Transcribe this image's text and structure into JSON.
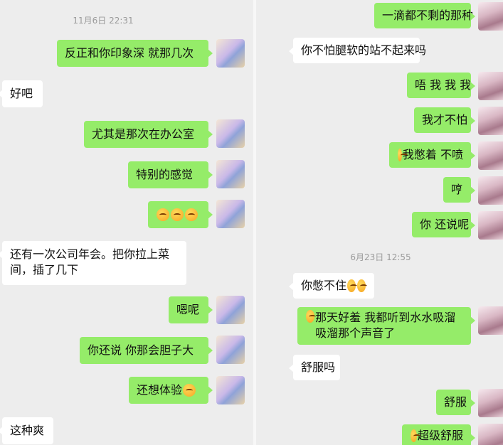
{
  "left": {
    "timestamp": "11月6日 22:31",
    "messages": [
      {
        "dir": "out",
        "text": "反正和你印象深 就那几次"
      },
      {
        "dir": "in",
        "text": "好吧"
      },
      {
        "dir": "out",
        "text": "尤其是那次在办公室"
      },
      {
        "dir": "out",
        "text": "特别的感觉"
      },
      {
        "dir": "out",
        "text": ""
      },
      {
        "dir": "in",
        "text": "还有一次公司年会。把你拉上菜间，插了几下"
      },
      {
        "dir": "out",
        "text": "嗯呢"
      },
      {
        "dir": "out",
        "text": "你还说 你那会胆子大"
      },
      {
        "dir": "out",
        "text": "还想体验"
      },
      {
        "dir": "in",
        "text": "这种爽"
      }
    ]
  },
  "right": {
    "timestamp": "6月23日 12:55",
    "messages": [
      {
        "dir": "out",
        "text": "一滴都不剩的那种"
      },
      {
        "dir": "in",
        "text": "你不怕腿软的站不起来吗"
      },
      {
        "dir": "out",
        "text": "唔 我 我 我"
      },
      {
        "dir": "out",
        "text": "我才不怕"
      },
      {
        "dir": "out",
        "text": "我憋着 不喷"
      },
      {
        "dir": "out",
        "text": "哼"
      },
      {
        "dir": "out",
        "text": "你 还说呢"
      },
      {
        "dir": "in",
        "text": "你憋不住"
      },
      {
        "dir": "out",
        "text": "那天好羞 我都听到水水吸溜吸溜那个声音了"
      },
      {
        "dir": "in",
        "text": "舒服吗"
      },
      {
        "dir": "out",
        "text": "舒服"
      },
      {
        "dir": "out",
        "text": "超级舒服"
      }
    ]
  },
  "icons": {
    "emoji": "smiling-emoji-icon",
    "avatar_self_left": "anime-avatar",
    "avatar_self_right": "girl-avatar"
  },
  "colors": {
    "outgoing_bubble": "#95ec69",
    "incoming_bubble": "#ffffff",
    "background": "#ededed",
    "timestamp": "#9b9b9b"
  }
}
